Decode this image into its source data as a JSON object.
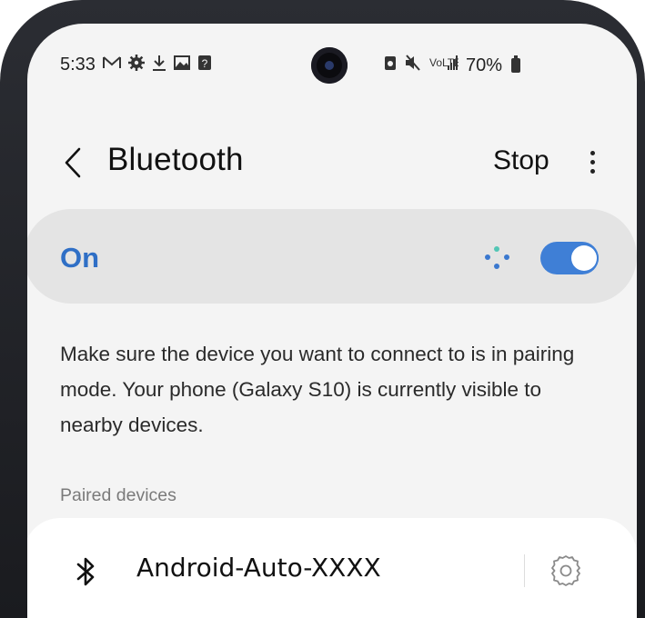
{
  "status_bar": {
    "time": "5:33",
    "left_icons": [
      "gmail-icon",
      "settings-icon",
      "download-icon",
      "gallery-icon",
      "notification-icon"
    ],
    "right_icons": [
      "battery-saver-icon",
      "mute-icon",
      "signal-icon"
    ],
    "battery": "70%"
  },
  "header": {
    "title": "Bluetooth",
    "stop_label": "Stop"
  },
  "toggle": {
    "label": "On",
    "state": true,
    "accent_color": "#3f7fd6"
  },
  "description": "Make sure the device you want to connect to is in pairing mode. Your phone (Galaxy S10) is currently visible to nearby devices.",
  "paired_devices": {
    "header": "Paired devices",
    "items": [
      {
        "name": "Android-Auto-XXXX",
        "icon": "bluetooth-icon"
      }
    ]
  }
}
